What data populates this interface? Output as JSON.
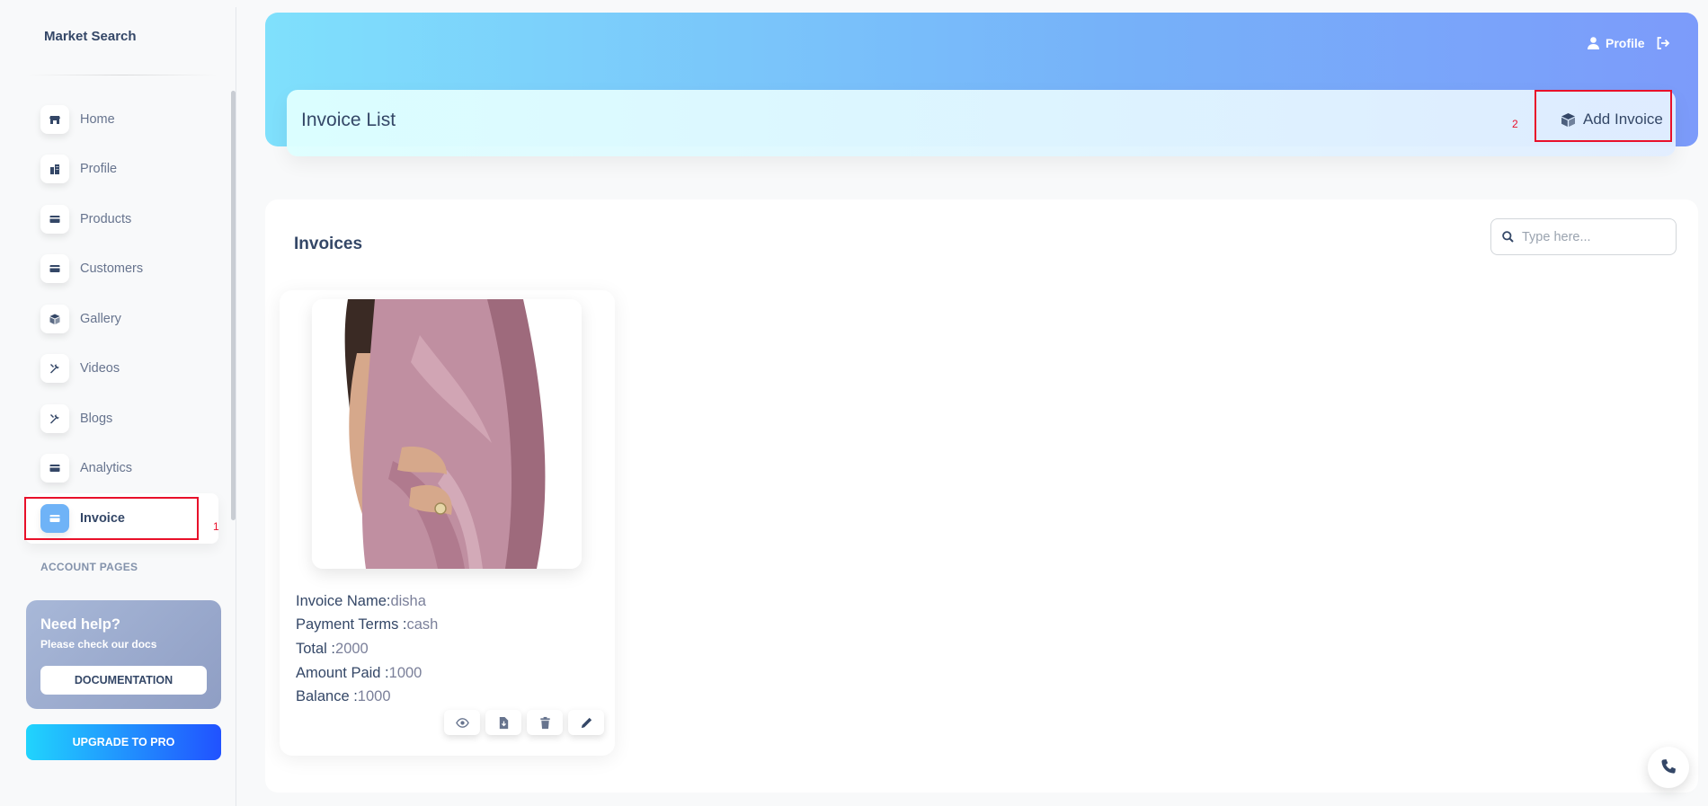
{
  "sidebar": {
    "brand": "Market Search",
    "items": [
      {
        "label": "Home",
        "icon": "shop-icon"
      },
      {
        "label": "Profile",
        "icon": "office-icon"
      },
      {
        "label": "Products",
        "icon": "credit-card-icon"
      },
      {
        "label": "Customers",
        "icon": "credit-card-icon"
      },
      {
        "label": "Gallery",
        "icon": "box-icon"
      },
      {
        "label": "Videos",
        "icon": "tools-icon"
      },
      {
        "label": "Blogs",
        "icon": "tools-icon"
      },
      {
        "label": "Analytics",
        "icon": "credit-card-icon"
      },
      {
        "label": "Invoice",
        "icon": "credit-card-icon"
      }
    ],
    "active_item": "Invoice",
    "marker_1": "1",
    "section_title": "ACCOUNT PAGES",
    "help": {
      "title": "Need help?",
      "subtitle": "Please check our docs",
      "button": "DOCUMENTATION"
    },
    "upgrade_button": "UPGRADE TO PRO"
  },
  "header": {
    "profile_label": "Profile",
    "page_title": "Invoice List",
    "marker_2": "2",
    "add_button": "Add Invoice"
  },
  "main": {
    "title": "Invoices",
    "search": {
      "placeholder": "Type here..."
    },
    "invoices": [
      {
        "name_label": "Invoice Name:",
        "name": "disha",
        "terms_label": "Payment Terms :",
        "terms": "cash",
        "total_label": "Total :",
        "total": "2000",
        "paid_label": "Amount Paid :",
        "paid": "1000",
        "balance_label": "Balance :",
        "balance": "1000",
        "image": "saree-photo"
      }
    ]
  },
  "colors": {
    "accent": "#344767",
    "muted": "#67748e",
    "highlight": "#e8102a",
    "header_gradient_start": "#7fe0fc",
    "header_gradient_end": "#7c9bfa",
    "upgrade_gradient_start": "#21d4fd",
    "upgrade_gradient_end": "#2152ff"
  }
}
